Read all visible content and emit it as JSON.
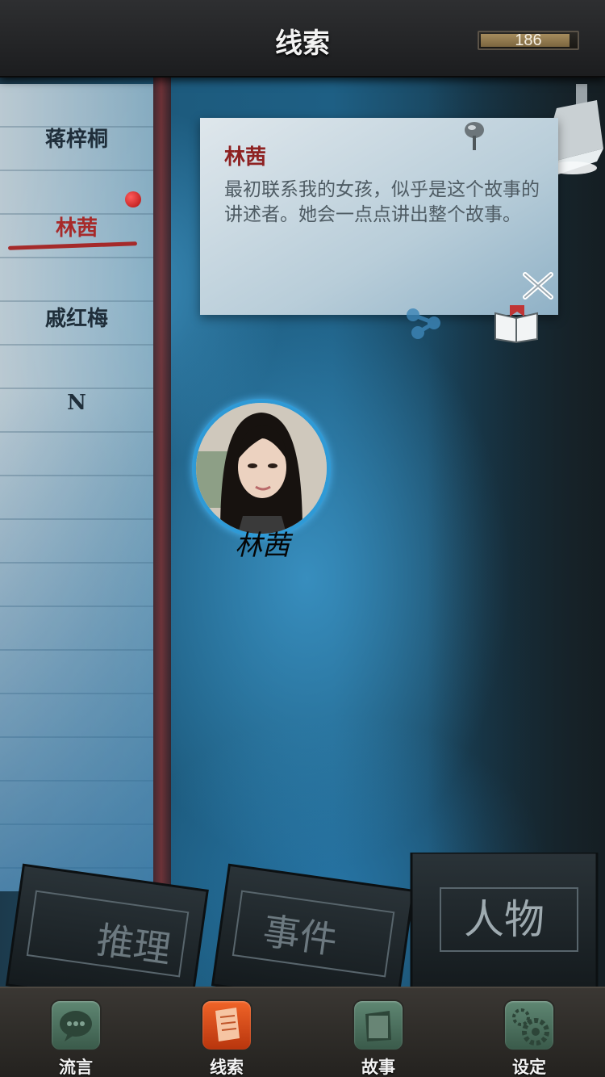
{
  "header": {
    "title": "线索",
    "coins": "186",
    "coin_bar_fill": 0.93
  },
  "notebook": {
    "tabs": [
      {
        "label": "蒋梓桐"
      },
      {
        "label": "林茜"
      },
      {
        "label": "戚红梅"
      },
      {
        "label": "N"
      }
    ],
    "active_index": 1
  },
  "card": {
    "title": "林茜",
    "description": "最初联系我的女孩，似乎是这个故事的讲述者。她会一点点讲出整个故事。"
  },
  "character": {
    "name": "林茜"
  },
  "books": [
    {
      "title": "推理"
    },
    {
      "title": "事件"
    },
    {
      "title": "人物"
    }
  ],
  "tabbar": {
    "items": [
      {
        "label": "流言",
        "icon": "speech-bubble-icon"
      },
      {
        "label": "线索",
        "icon": "note-paper-icon"
      },
      {
        "label": "故事",
        "icon": "book-icon"
      },
      {
        "label": "设定",
        "icon": "gear-icon"
      }
    ],
    "active_index": 1
  },
  "colors": {
    "accent": "#a72a2a",
    "node_ring": "#2f9ad6",
    "active_tab": "#f06428",
    "inactive_tab": "#5f8773"
  }
}
